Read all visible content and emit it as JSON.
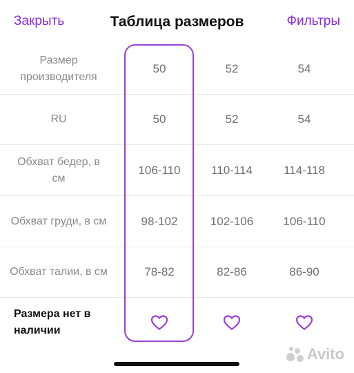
{
  "header": {
    "close_label": "Закрыть",
    "title": "Таблица размеров",
    "filters_label": "Фильтры"
  },
  "colors": {
    "accent": "#8a2be2",
    "highlight_border": "#9b3fd6"
  },
  "table": {
    "rows": [
      {
        "label": "Размер производителя",
        "values": [
          "50",
          "52",
          "54"
        ]
      },
      {
        "label": "RU",
        "values": [
          "50",
          "52",
          "54"
        ]
      },
      {
        "label": "Обхват бедер, в см",
        "values": [
          "106-110",
          "110-114",
          "114-118"
        ]
      },
      {
        "label": "Обхват груди, в см",
        "values": [
          "98-102",
          "102-106",
          "106-110"
        ]
      },
      {
        "label": "Обхват талии, в см",
        "values": [
          "78-82",
          "82-86",
          "86-90"
        ]
      }
    ],
    "availability_label": "Размера нет в наличии",
    "favorite_icon": "heart-outline-icon",
    "selected_column": "50"
  },
  "watermark": {
    "text": "Avito"
  }
}
